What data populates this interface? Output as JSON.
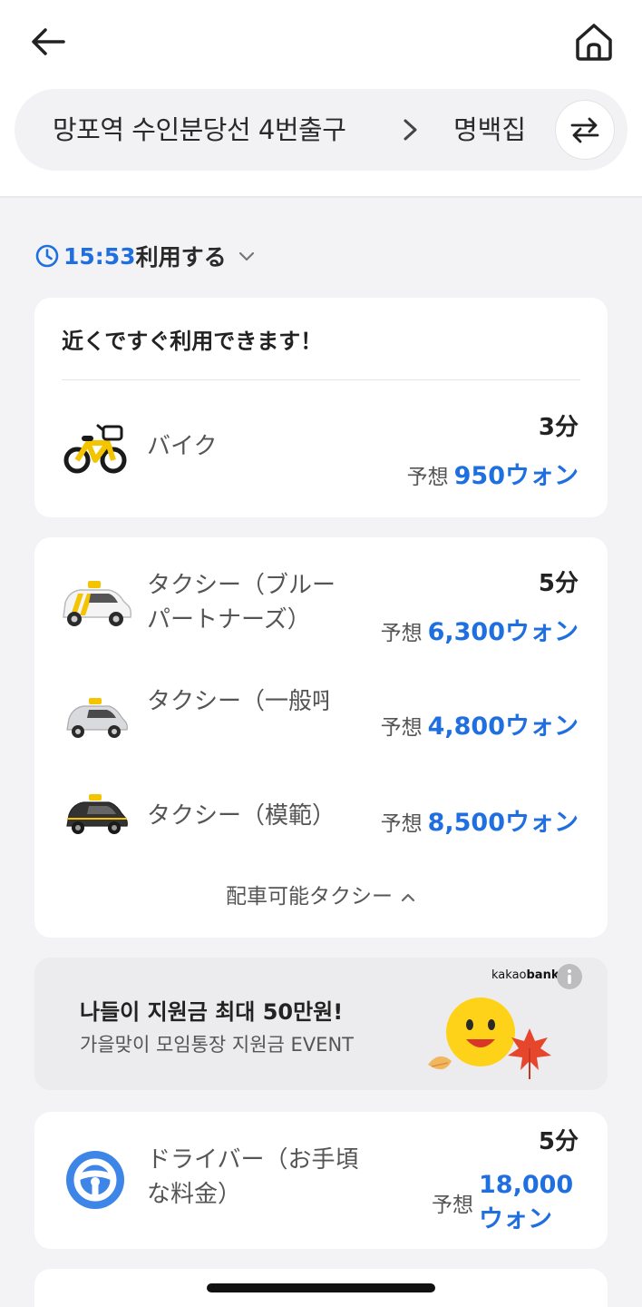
{
  "header": {
    "route_from": "망포역 수인분당선 4번출구",
    "route_to": "명백집"
  },
  "time_selector": {
    "time": "15:53",
    "label": "利用する"
  },
  "nearby_card": {
    "title": "近くですぐ利用できます！",
    "items": [
      {
        "name": "バイク",
        "time": "3分",
        "price_prefix": "予想",
        "price": "950ウォン",
        "icon": "bike-icon"
      }
    ]
  },
  "taxi_card": {
    "items": [
      {
        "name": "タクシー（ブルーパートナーズ）",
        "time": "5分",
        "price_prefix": "予想",
        "price": "6,300ウォン",
        "icon": "blue-taxi-icon"
      },
      {
        "name": "タクシー（一般呼び出…",
        "time": "",
        "price_prefix": "予想",
        "price": "4,800ウォン",
        "icon": "general-taxi-icon"
      },
      {
        "name": "タクシー（模範）",
        "time": "",
        "price_prefix": "予想",
        "price": "8,500ウォン",
        "icon": "deluxe-taxi-icon"
      }
    ],
    "more_label": "配車可能タクシー"
  },
  "banner": {
    "brand_prefix": "kakao",
    "brand_suffix": "bank",
    "title": "나들이 지원금 최대 50만원!",
    "subtitle": "가을맞이 모임통장 지원금 EVENT"
  },
  "driver_card": {
    "name": "ドライバー（お手頃な料金）",
    "time": "5分",
    "price_prefix": "予想",
    "price": "18,000ウォン",
    "icon": "steering-wheel-icon"
  },
  "colors": {
    "accent": "#1f6fe0",
    "background": "#f3f3f5",
    "card": "#ffffff",
    "taxi_yellow": "#f5c400"
  }
}
